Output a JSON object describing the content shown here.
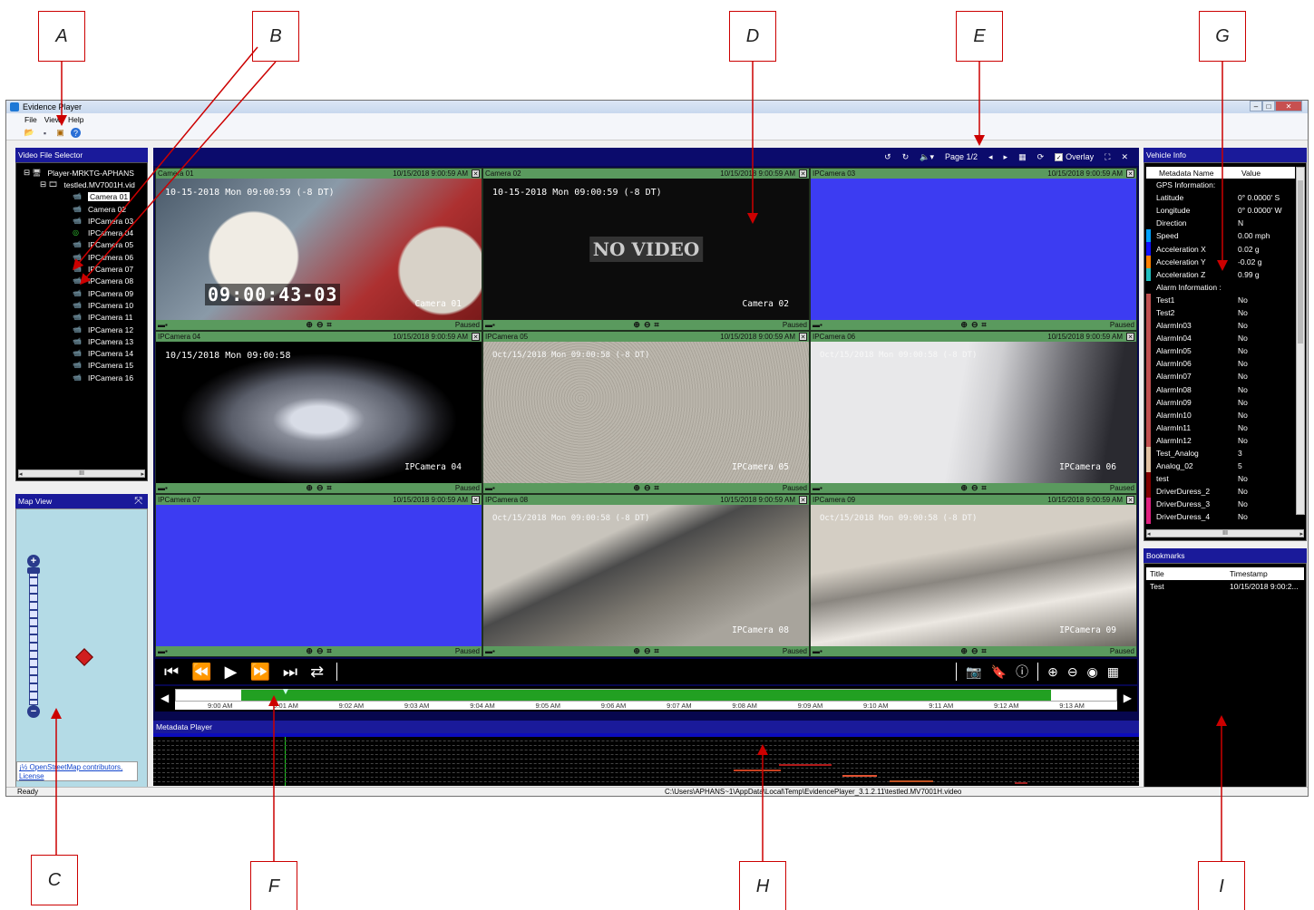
{
  "callouts": {
    "a": "A",
    "b": "B",
    "c": "C",
    "d": "D",
    "e": "E",
    "f": "F",
    "g": "G",
    "h": "H",
    "i": "I"
  },
  "window": {
    "title": "Evidence Player",
    "menu": [
      "File",
      "View",
      "Help"
    ]
  },
  "video_selector": {
    "title": "Video File Selector",
    "root": "Player-MRKTG-APHANS",
    "file": "testled.MV7001H.vid",
    "cameras": [
      "Camera 01",
      "Camera 02",
      "IPCamera 03",
      "IPCamera 04",
      "IPCamera 05",
      "IPCamera 06",
      "IPCamera 07",
      "IPCamera 08",
      "IPCamera 09",
      "IPCamera 10",
      "IPCamera 11",
      "IPCamera 12",
      "IPCamera 13",
      "IPCamera 14",
      "IPCamera 15",
      "IPCamera 16"
    ],
    "selected": "Camera 01",
    "scroll_glyph": "III"
  },
  "map": {
    "title": "Map View",
    "attribution1": "¡½ OpenStreetMap contributors,",
    "attribution2": "License"
  },
  "video_toolbar": {
    "page": "Page 1/2",
    "overlay": "Overlay"
  },
  "tiles": [
    {
      "name": "Camera 01",
      "time": "10/15/2018 9:00:59 AM",
      "status": "Paused",
      "osd": "10-15-2018 Mon 09:00:59 (-8 DT)",
      "label": "Camera 01",
      "bigtime": "09:00:43-03"
    },
    {
      "name": "Camera 02",
      "time": "10/15/2018 9:00:59 AM",
      "status": "Paused",
      "osd": "10-15-2018 Mon 09:00:59 (-8 DT)",
      "label": "Camera 02",
      "novideo": "NO VIDEO"
    },
    {
      "name": "IPCamera 03",
      "time": "10/15/2018 9:00:59 AM",
      "status": "Paused"
    },
    {
      "name": "IPCamera 04",
      "time": "10/15/2018 9:00:59 AM",
      "status": "Paused",
      "osd": "10/15/2018 Mon 09:00:58",
      "label": "IPCamera 04"
    },
    {
      "name": "IPCamera 05",
      "time": "10/15/2018 9:00:59 AM",
      "status": "Paused",
      "osd": "Oct/15/2018 Mon 09:00:58 (-8 DT)",
      "label": "IPCamera 05"
    },
    {
      "name": "IPCamera 06",
      "time": "10/15/2018 9:00:59 AM",
      "status": "Paused",
      "osd": "Oct/15/2018 Mon 09:00:58 (-8 DT)",
      "label": "IPCamera 06"
    },
    {
      "name": "IPCamera 07",
      "time": "10/15/2018 9:00:59 AM",
      "status": "Paused"
    },
    {
      "name": "IPCamera 08",
      "time": "10/15/2018 9:00:59 AM",
      "status": "Paused",
      "osd": "Oct/15/2018 Mon 09:00:58 (-8 DT)",
      "label": "IPCamera 08"
    },
    {
      "name": "IPCamera 09",
      "time": "10/15/2018 9:00:59 AM",
      "status": "Paused",
      "osd": "Oct/15/2018 Mon 09:00:58 (-8 DT)",
      "label": "IPCamera 09"
    }
  ],
  "timeline": {
    "labels": [
      "9:00 AM",
      "9:01 AM",
      "9:02 AM",
      "9:03 AM",
      "9:04 AM",
      "9:05 AM",
      "9:06 AM",
      "9:07 AM",
      "9:08 AM",
      "9:09 AM",
      "9:10 AM",
      "9:11 AM",
      "9:12 AM",
      "9:13 AM"
    ]
  },
  "metadata_player": {
    "title": "Metadata Player"
  },
  "vehicle_info": {
    "title": "Vehicle Info",
    "col_name": "Metadata Name",
    "col_value": "Value",
    "rows": [
      {
        "n": "GPS Information:",
        "v": "",
        "c": ""
      },
      {
        "n": "Latitude",
        "v": "0° 0.0000' S",
        "c": ""
      },
      {
        "n": "Longitude",
        "v": "0° 0.0000' W",
        "c": ""
      },
      {
        "n": "Direction",
        "v": "N",
        "c": ""
      },
      {
        "n": "Speed",
        "v": "0.00 mph",
        "c": "#00a0ff"
      },
      {
        "n": "Acceleration X",
        "v": "0.02 g",
        "c": "#1010ff"
      },
      {
        "n": "Acceleration Y",
        "v": "-0.02 g",
        "c": "#ff8000"
      },
      {
        "n": "Acceleration Z",
        "v": "0.99 g",
        "c": "#20c0c0"
      },
      {
        "n": "Alarm Information :",
        "v": "",
        "c": ""
      },
      {
        "n": "Test1",
        "v": "No",
        "c": "#c05050"
      },
      {
        "n": "Test2",
        "v": "No",
        "c": "#c05050"
      },
      {
        "n": "AlarmIn03",
        "v": "No",
        "c": "#c05050"
      },
      {
        "n": "AlarmIn04",
        "v": "No",
        "c": "#c05050"
      },
      {
        "n": "AlarmIn05",
        "v": "No",
        "c": "#c05050"
      },
      {
        "n": "AlarmIn06",
        "v": "No",
        "c": "#c05050"
      },
      {
        "n": "AlarmIn07",
        "v": "No",
        "c": "#c05050"
      },
      {
        "n": "AlarmIn08",
        "v": "No",
        "c": "#c05050"
      },
      {
        "n": "AlarmIn09",
        "v": "No",
        "c": "#c05050"
      },
      {
        "n": "AlarmIn10",
        "v": "No",
        "c": "#c05050"
      },
      {
        "n": "AlarmIn11",
        "v": "No",
        "c": "#c05050"
      },
      {
        "n": "AlarmIn12",
        "v": "No",
        "c": "#c05050"
      },
      {
        "n": "Test_Analog",
        "v": "3",
        "c": "#e0c0a0"
      },
      {
        "n": "Analog_02",
        "v": "5",
        "c": "#e0c0a0"
      },
      {
        "n": "test",
        "v": "No",
        "c": "#800000"
      },
      {
        "n": "DriverDuress_2",
        "v": "No",
        "c": "#800000"
      },
      {
        "n": "DriverDuress_3",
        "v": "No",
        "c": "#e02080"
      },
      {
        "n": "DriverDuress_4",
        "v": "No",
        "c": "#e02080"
      }
    ]
  },
  "bookmarks": {
    "title": "Bookmarks",
    "col_title": "Title",
    "col_time": "Timestamp",
    "rows": [
      {
        "title": "Test",
        "time": "10/15/2018 9:00:2..."
      }
    ]
  },
  "status": {
    "left": "Ready",
    "path": "C:\\Users\\APHANS~1\\AppData\\Local\\Temp\\EvidencePlayer_3.1.2.11\\testled.MV7001H.video"
  }
}
